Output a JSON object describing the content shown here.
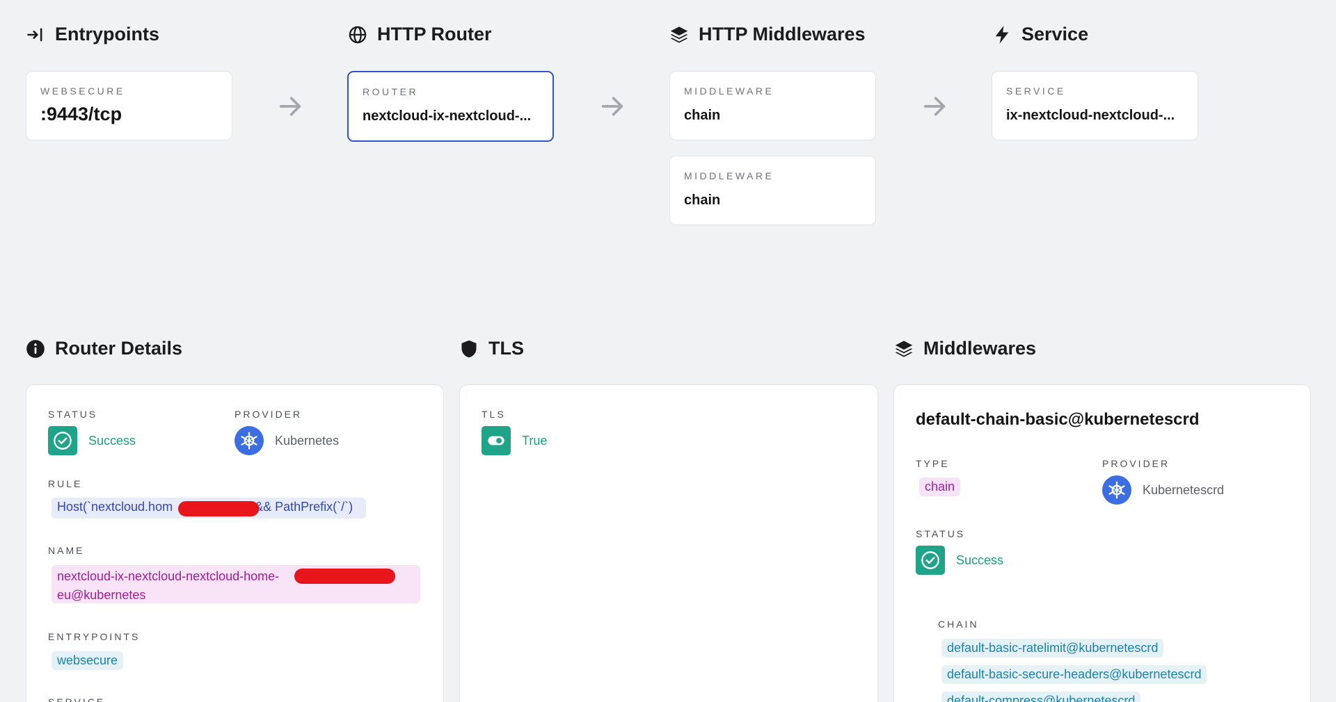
{
  "flow": {
    "entrypoints": {
      "heading": "Entrypoints",
      "card_label": "WEBSECURE",
      "card_value": ":9443/tcp"
    },
    "router": {
      "heading": "HTTP Router",
      "card_label": "ROUTER",
      "card_value": "nextcloud-ix-nextcloud-..."
    },
    "middlewares": {
      "heading": "HTTP Middlewares",
      "cards": [
        {
          "label": "MIDDLEWARE",
          "value": "chain"
        },
        {
          "label": "MIDDLEWARE",
          "value": "chain"
        }
      ]
    },
    "service": {
      "heading": "Service",
      "card_label": "SERVICE",
      "card_value": "ix-nextcloud-nextcloud-..."
    }
  },
  "router_details": {
    "heading": "Router Details",
    "status_label": "STATUS",
    "status_value": "Success",
    "provider_label": "PROVIDER",
    "provider_value": "Kubernetes",
    "rule_label": "RULE",
    "rule_part1": "Host(`nextcloud.hom",
    "rule_part2": "&& PathPrefix(`/`)",
    "name_label": "NAME",
    "name_line1": "nextcloud-ix-nextcloud-nextcloud-home-",
    "name_line2": "eu@kubernetes",
    "entrypoints_label": "ENTRYPOINTS",
    "entrypoint_value": "websecure",
    "service_label": "SERVICE"
  },
  "tls": {
    "heading": "TLS",
    "tls_label": "TLS",
    "tls_value": "True"
  },
  "middlewares_panel": {
    "heading": "Middlewares",
    "title": "default-chain-basic@kubernetescrd",
    "type_label": "TYPE",
    "type_value": "chain",
    "provider_label": "PROVIDER",
    "provider_value": "Kubernetescrd",
    "status_label": "STATUS",
    "status_value": "Success",
    "chain_label": "CHAIN",
    "chain_items": [
      "default-basic-ratelimit@kubernetescrd",
      "default-basic-secure-headers@kubernetescrd",
      "default-compress@kubernetescrd"
    ]
  },
  "colors": {
    "accent": "#2f54c9",
    "success": "#1fa48a",
    "provider": "#3b6ee0",
    "redaction": "#e8161a"
  },
  "icons": [
    "entrypoint-icon",
    "globe-icon",
    "layers-icon",
    "lightning-icon",
    "info-icon",
    "shield-icon",
    "arrow-right-icon",
    "check-icon",
    "kubernetes-icon",
    "toggle-icon"
  ]
}
